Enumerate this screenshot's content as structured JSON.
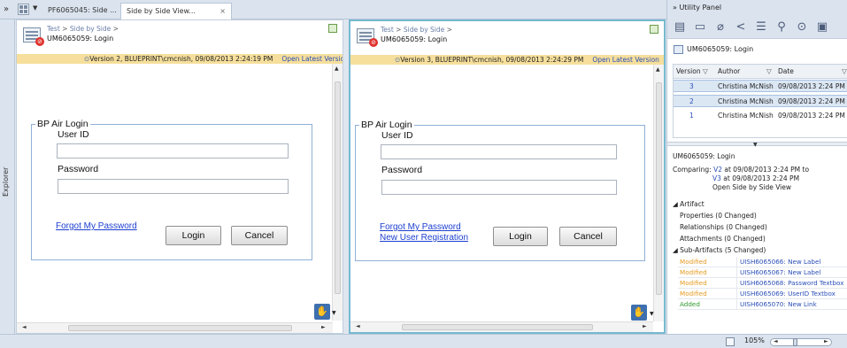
{
  "tabs": {
    "chevron": "»",
    "tab1_label": "PF6065045: Side ...",
    "tab2_label": "Side by Side View...",
    "close": "×"
  },
  "explorer": {
    "label": "Explorer"
  },
  "left_pane": {
    "breadcrumb_root": "Test",
    "breadcrumb_sep": ">",
    "breadcrumb_link": "Side by Side",
    "breadcrumb_tail": ">",
    "title": "UM6065059: Login",
    "version_text": "Version 2, BLUEPRINT\\cmcnish, 09/08/2013 2:24:19 PM",
    "open_latest": "Open Latest Version",
    "form": {
      "legend": "BP Air Login",
      "user_id_label": "User ID",
      "password_label": "Password",
      "forgot_link": "Forgot My Password",
      "login_button": "Login",
      "cancel_button": "Cancel"
    }
  },
  "right_pane": {
    "breadcrumb_root": "Test",
    "breadcrumb_sep": ">",
    "breadcrumb_link": "Side by Side",
    "breadcrumb_tail": ">",
    "title": "UM6065059: Login",
    "version_text": "Version 3, BLUEPRINT\\cmcnish, 09/08/2013 2:24:29 PM",
    "open_latest": "Open Latest Version",
    "form": {
      "legend": "BP Air Login",
      "user_id_label": "User ID",
      "password_label": "Password",
      "forgot_link": "Forgot My Password",
      "new_user_link": "New User Registration",
      "login_button": "Login",
      "cancel_button": "Cancel"
    }
  },
  "utility": {
    "header": "Utility Panel",
    "artifact_title": "UM6065059: Login",
    "versions": {
      "col_version": "Version",
      "col_author": "Author",
      "col_date": "Date",
      "rows": [
        {
          "version": "3",
          "author": "Christina McNish",
          "date": "09/08/2013 2:24 PM"
        },
        {
          "version": "2",
          "author": "Christina McNish",
          "date": "09/08/2013 2:24 PM"
        },
        {
          "version": "1",
          "author": "Christina McNish",
          "date": "09/08/2013 2:24 PM"
        }
      ]
    },
    "compare": {
      "name": "UM6065059: Login",
      "comparing_label": "Comparing:",
      "v_from": "V2",
      "v_from_rest": "at 09/08/2013 2:24 PM to",
      "v_to": "V3",
      "v_to_rest": "at 09/08/2013 2:24 PM",
      "open_link": "Open Side by Side View"
    },
    "artifact": {
      "section": "Artifact",
      "properties": "Properties (0 Changed)",
      "relationships": "Relationships (0 Changed)",
      "attachments": "Attachments (0 Changed)"
    },
    "sub_artifacts": {
      "section": "Sub-Artifacts (5 Changed)",
      "rows": [
        {
          "status": "Modified",
          "name": "UISH6065066: New Label"
        },
        {
          "status": "Modified",
          "name": "UISH6065067: New Label"
        },
        {
          "status": "Modified",
          "name": "UISH6065068: Password Textbox"
        },
        {
          "status": "Modified",
          "name": "UISH6065069: UserID Textbox"
        },
        {
          "status": "Added",
          "name": "UISH6065070: New Link"
        }
      ]
    }
  },
  "status_bar": {
    "zoom": "105%",
    "zoom_level": 0.3
  },
  "colors": {
    "modified": "#e69a1f",
    "added": "#2e9a2e",
    "version_bar": "#f6df9c",
    "active_pane_border": "#76b9cf"
  }
}
